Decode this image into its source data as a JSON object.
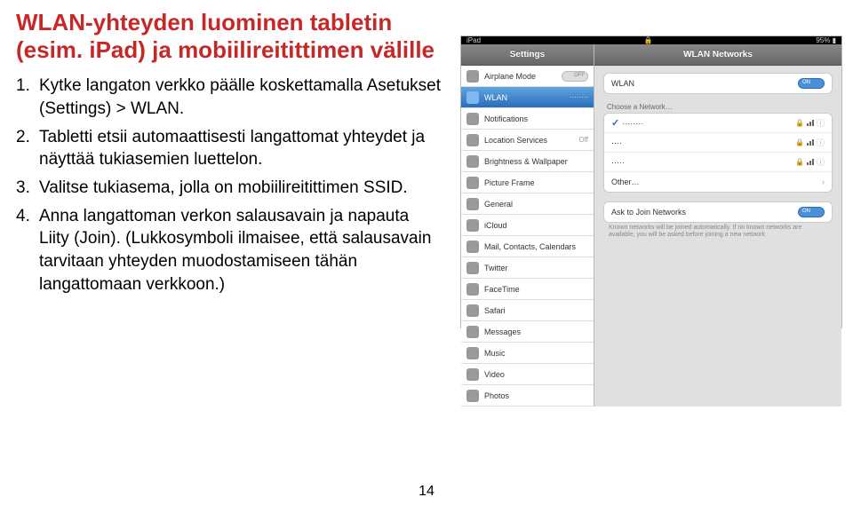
{
  "doc": {
    "title": "WLAN-yhteyden luominen tabletin (esim. iPad) ja mobiilireitittimen välille",
    "steps": [
      "Kytke langaton verkko päälle koskettamalla Asetukset (Settings) > WLAN.",
      "Tabletti etsii automaattisesti langattomat yhteydet ja näyttää tukiasemien luettelon.",
      "Valitse tukiasema, jolla on mobiilireitittimen SSID.",
      "Anna langattoman verkon salausavain ja napauta Liity (Join).\n(Lukkosymboli ilmaisee, että salausavain tarvitaan yhteyden muodostamiseen tähän langattomaan verkkoon.)"
    ],
    "page_number": "14"
  },
  "ipad": {
    "status": {
      "left": "iPad",
      "center": "",
      "right": "95%"
    },
    "sidebar_title": "Settings",
    "panel_title": "WLAN Networks",
    "sidebar": [
      {
        "label": "Airplane Mode",
        "icon": "airplane",
        "right": "off-toggle"
      },
      {
        "label": "WLAN",
        "icon": "wifi",
        "right": "········",
        "selected": true
      },
      {
        "label": "Notifications",
        "icon": "bell"
      },
      {
        "label": "Location Services",
        "icon": "location",
        "right_text": "Off"
      },
      {
        "label": "Brightness & Wallpaper",
        "icon": "brightness"
      },
      {
        "label": "Picture Frame",
        "icon": "frame"
      },
      {
        "label": "General",
        "icon": "gear"
      },
      {
        "label": "iCloud",
        "icon": "cloud"
      },
      {
        "label": "Mail, Contacts, Calendars",
        "icon": "mail"
      },
      {
        "label": "Twitter",
        "icon": "twitter"
      },
      {
        "label": "FaceTime",
        "icon": "facetime"
      },
      {
        "label": "Safari",
        "icon": "safari"
      },
      {
        "label": "Messages",
        "icon": "messages"
      },
      {
        "label": "Music",
        "icon": "music"
      },
      {
        "label": "Video",
        "icon": "video"
      },
      {
        "label": "Photos",
        "icon": "photos"
      }
    ],
    "wlan_row": "WLAN",
    "choose_label": "Choose a Network…",
    "networks": [
      {
        "name": "········",
        "checked": true,
        "locked": true
      },
      {
        "name": "····",
        "locked": true
      },
      {
        "name": "·····",
        "locked": true
      },
      {
        "name": "Other…",
        "locked": false
      }
    ],
    "ask_label": "Ask to Join Networks",
    "ask_note": "Known networks will be joined automatically. If no known networks are available, you will be asked before joining a new network."
  }
}
